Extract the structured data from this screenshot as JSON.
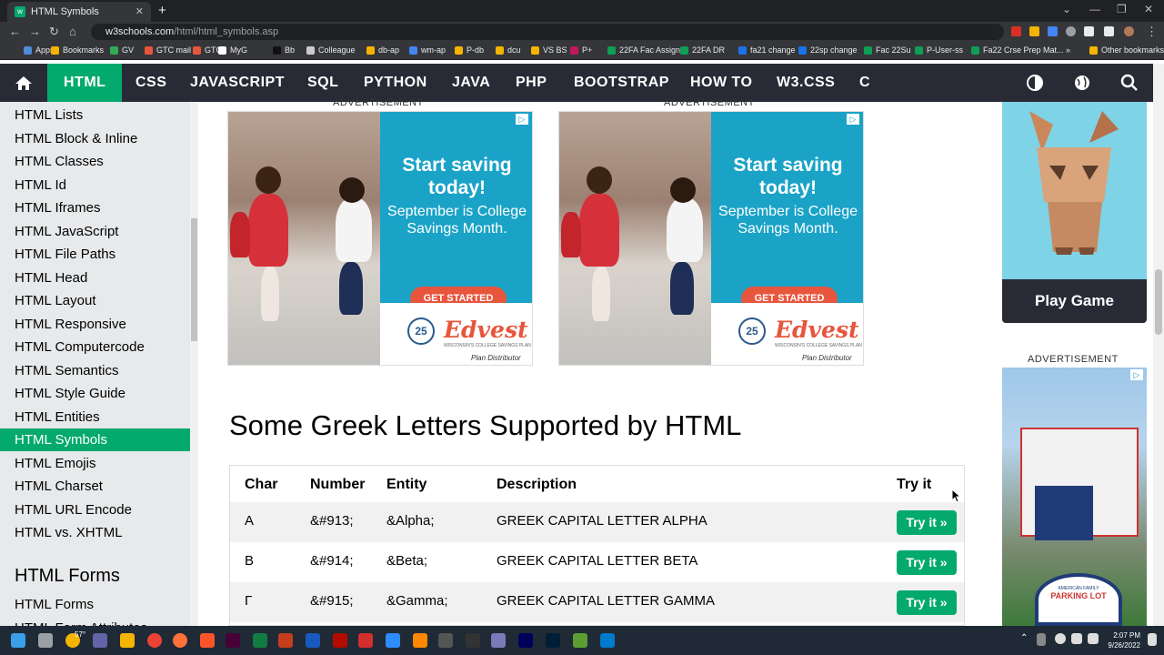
{
  "browser": {
    "tab_title": "HTML Symbols",
    "tab_favicon": "w",
    "url_host": "w3schools.com",
    "url_path": "/html/html_symbols.asp",
    "bookmarks": [
      {
        "label": "Apps",
        "color": "#4f8bd6"
      },
      {
        "label": "Bookmarks",
        "color": "#f4b400"
      },
      {
        "label": "GV",
        "color": "#34a853"
      },
      {
        "label": "GTC mail",
        "color": "#e8553d"
      },
      {
        "label": "GTC",
        "color": "#e8553d"
      },
      {
        "label": "MyG",
        "color": "#ffffff"
      },
      {
        "label": "Bb",
        "color": "#111111"
      },
      {
        "label": "Colleague",
        "color": "#cccccc"
      },
      {
        "label": "db-ap",
        "color": "#f4b400"
      },
      {
        "label": "wm-ap",
        "color": "#4285f4"
      },
      {
        "label": "P-db",
        "color": "#f4b400"
      },
      {
        "label": "dcu",
        "color": "#f4b400"
      },
      {
        "label": "VS BS",
        "color": "#f4b400"
      },
      {
        "label": "P+",
        "color": "#c2185b"
      },
      {
        "label": "22FA Fac Assign",
        "color": "#0f9d58"
      },
      {
        "label": "22FA DR",
        "color": "#0f9d58"
      },
      {
        "label": "fa21 change",
        "color": "#1a73e8"
      },
      {
        "label": "22sp change",
        "color": "#1a73e8"
      },
      {
        "label": "Fac 22Su",
        "color": "#0f9d58"
      },
      {
        "label": "P-User-ss",
        "color": "#0f9d58"
      },
      {
        "label": "Fa22 Crse Prep Mat...",
        "color": "#0f9d58"
      }
    ],
    "other_bookmarks": "Other bookmarks"
  },
  "topnav": {
    "home_icon": "home-icon",
    "items": [
      "HTML",
      "CSS",
      "JAVASCRIPT",
      "SQL",
      "PYTHON",
      "JAVA",
      "PHP",
      "BOOTSTRAP",
      "HOW TO",
      "W3.CSS",
      "C"
    ],
    "active": "HTML",
    "right_icons": [
      "contrast-icon",
      "globe-icon",
      "search-icon"
    ]
  },
  "sidebar": {
    "items": [
      "HTML Lists",
      "HTML Block & Inline",
      "HTML Classes",
      "HTML Id",
      "HTML Iframes",
      "HTML JavaScript",
      "HTML File Paths",
      "HTML Head",
      "HTML Layout",
      "HTML Responsive",
      "HTML Computercode",
      "HTML Semantics",
      "HTML Style Guide",
      "HTML Entities",
      "HTML Symbols",
      "HTML Emojis",
      "HTML Charset",
      "HTML URL Encode",
      "HTML vs. XHTML"
    ],
    "active": "HTML Symbols",
    "section_heading": "HTML Forms",
    "section_items": [
      "HTML Forms",
      "HTML Form Attributes"
    ]
  },
  "ads": {
    "label": "ADVERTISEMENT",
    "headline": "Start saving today!",
    "body": "September is College Savings Month.",
    "cta": "GET STARTED",
    "brand": "Edvest",
    "seal": "25",
    "sub": "WISCONSIN'S COLLEGE SAVINGS PLAN",
    "distributor": "Plan Distributor"
  },
  "main": {
    "title": "Some Greek Letters Supported by HTML",
    "columns": [
      "Char",
      "Number",
      "Entity",
      "Description",
      "Try it"
    ],
    "rows": [
      {
        "char": "Α",
        "number": "&#913;",
        "entity": "&Alpha;",
        "description": "GREEK CAPITAL LETTER ALPHA",
        "try": "Try it »"
      },
      {
        "char": "Β",
        "number": "&#914;",
        "entity": "&Beta;",
        "description": "GREEK CAPITAL LETTER BETA",
        "try": "Try it »"
      },
      {
        "char": "Γ",
        "number": "&#915;",
        "entity": "&Gamma;",
        "description": "GREEK CAPITAL LETTER GAMMA",
        "try": "Try it »"
      }
    ]
  },
  "right_ads": {
    "game_button": "Play Game",
    "label": "ADVERTISEMENT",
    "badge_top": "AMERICAN FAMILY",
    "badge_main": "PARKING LOT"
  },
  "taskbar": {
    "weather": "57°",
    "time": "2:07 PM",
    "date": "9/26/2022"
  }
}
